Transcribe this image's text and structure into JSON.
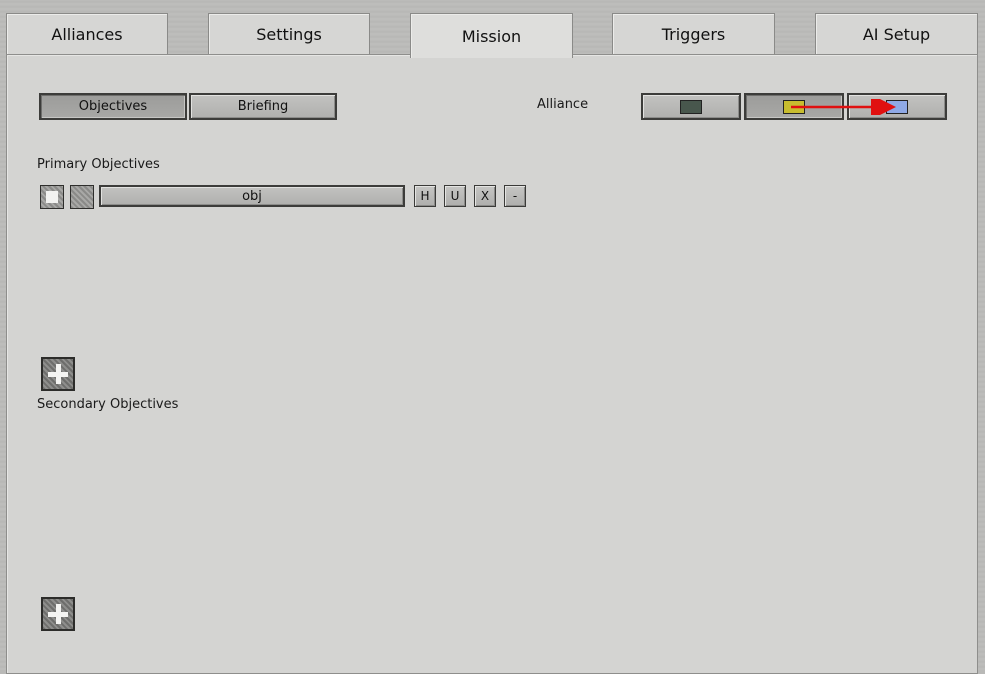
{
  "tabs": [
    {
      "label": "Alliances"
    },
    {
      "label": "Settings"
    },
    {
      "label": "Mission"
    },
    {
      "label": "Triggers"
    },
    {
      "label": "AI Setup"
    }
  ],
  "active_tab": "Mission",
  "subtabs": {
    "objectives_label": "Objectives",
    "briefing_label": "Briefing"
  },
  "alliance": {
    "label": "Alliance",
    "swatches": [
      {
        "color": "#48574d"
      },
      {
        "color": "#c8bd2f"
      },
      {
        "color": "#8fa9e6"
      }
    ],
    "arrow_color": "#e01010"
  },
  "primary": {
    "heading": "Primary Objectives",
    "objective_text": "obj",
    "buttons": {
      "h": "H",
      "u": "U",
      "x": "X",
      "minus": "-"
    }
  },
  "secondary": {
    "heading": "Secondary Objectives"
  }
}
